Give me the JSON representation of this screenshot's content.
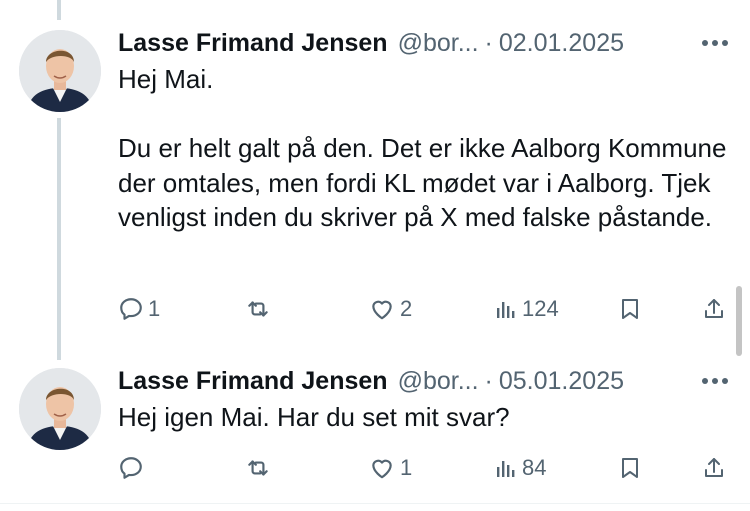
{
  "tweets": [
    {
      "author_name": "Lasse Frimand Jensen",
      "handle": "@bor...",
      "separator": "·",
      "date": "02.01.2025",
      "paragraphs": [
        "Hej Mai.",
        "Du er helt galt på den. Det er ikke Aalborg Kommune der omtales, men fordi KL mødet var i Aalborg. Tjek venligst inden du skriver på X med falske påstande."
      ],
      "actions": {
        "replies": "1",
        "reposts": "",
        "likes": "2",
        "views": "124"
      },
      "icons": [
        "reply-icon",
        "repost-icon",
        "like-icon",
        "views-icon",
        "bookmark-icon",
        "share-icon",
        "more-icon"
      ]
    },
    {
      "author_name": "Lasse Frimand Jensen",
      "handle": "@bor...",
      "separator": "·",
      "date": "05.01.2025",
      "paragraphs": [
        "Hej igen Mai. Har du set mit svar?"
      ],
      "actions": {
        "replies": "",
        "reposts": "",
        "likes": "1",
        "views": "84"
      },
      "icons": [
        "reply-icon",
        "repost-icon",
        "like-icon",
        "views-icon",
        "bookmark-icon",
        "share-icon",
        "more-icon"
      ]
    }
  ],
  "colors": {
    "text": "#0f1419",
    "muted": "#536471",
    "thread_line": "#cfd9de"
  }
}
